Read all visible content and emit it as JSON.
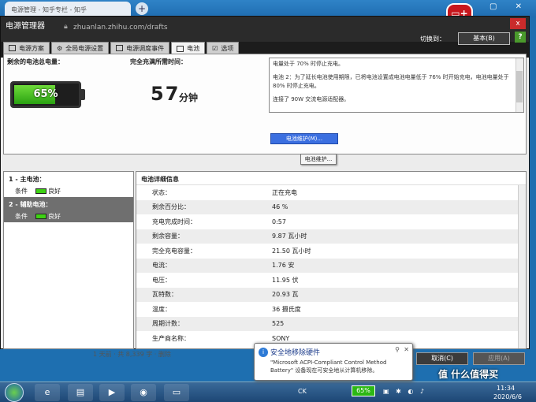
{
  "browser": {
    "tab_title": "电源管理 - 知乎专栏 - 知乎",
    "url": "zhuanlan.zhihu.com/drafts"
  },
  "app": {
    "title": "电源管理器",
    "switch_label": "切换到：",
    "mode_button": "基本(B)",
    "help": "?",
    "close": "x"
  },
  "tabs": [
    "电源方案",
    "全局电源设置",
    "电源调度事件",
    "电池",
    "选项"
  ],
  "summary": {
    "remaining_label": "剩余的电池总电量：",
    "battery_percent": "65%",
    "battery_level": 0.65,
    "charge_time_label": "完全充满所需时间：",
    "charge_time_value": "57",
    "charge_time_unit": "分钟"
  },
  "messages": [
    "电量处于 70% 时停止充电。",
    "电池 2：为了延长电池使用期限，已将电池设置成电池电量低于 76% 时开始充电，电池电量处于 80% 时停止充电。",
    "连接了 90W 交流电源适配器。"
  ],
  "maintenance": {
    "button": "电池维护(M)...",
    "tooltip": "电池维护..."
  },
  "battery_list": [
    {
      "title": "1 - 主电池：",
      "condition_label": "条件",
      "condition_value": "良好"
    },
    {
      "title": "2 - 辅助电池：",
      "condition_label": "条件",
      "condition_value": "良好"
    }
  ],
  "details": {
    "header": "电池详细信息",
    "rows": [
      {
        "k": "状态：",
        "v": "正在充电"
      },
      {
        "k": "剩余百分比：",
        "v": "46 %"
      },
      {
        "k": "充电完成时间：",
        "v": "0:57"
      },
      {
        "k": "剩余容量：",
        "v": "9.87 瓦小时"
      },
      {
        "k": "完全充电容量：",
        "v": "21.50 瓦小时"
      },
      {
        "k": "电流：",
        "v": "1.76 安"
      },
      {
        "k": "电压：",
        "v": "11.95 伏"
      },
      {
        "k": "瓦特数：",
        "v": "20.93 瓦"
      },
      {
        "k": "温度：",
        "v": "36 摄氏度"
      },
      {
        "k": "周期计数：",
        "v": "525"
      },
      {
        "k": "生产商名称：",
        "v": "SONY"
      }
    ]
  },
  "footer": {
    "bg_stats": "1 天前 · 共 8,339 字 · 删除",
    "cancel": "取消(C)",
    "apply": "应用(A)"
  },
  "notification": {
    "title": "安全地移除硬件",
    "text": "\"Microsoft ACPI-Compliant Control Method Battery\" 设备现在可安全地从计算机移除。"
  },
  "taskbar": {
    "lang": "CK",
    "battery": "65%",
    "time": "11:34",
    "date": "2020/6/6"
  },
  "watermark": "值 什么值得买",
  "colors": {
    "accent": "#3b6fe0",
    "battery_green": "#3ed214",
    "titlebar": "#2b2b2b"
  }
}
